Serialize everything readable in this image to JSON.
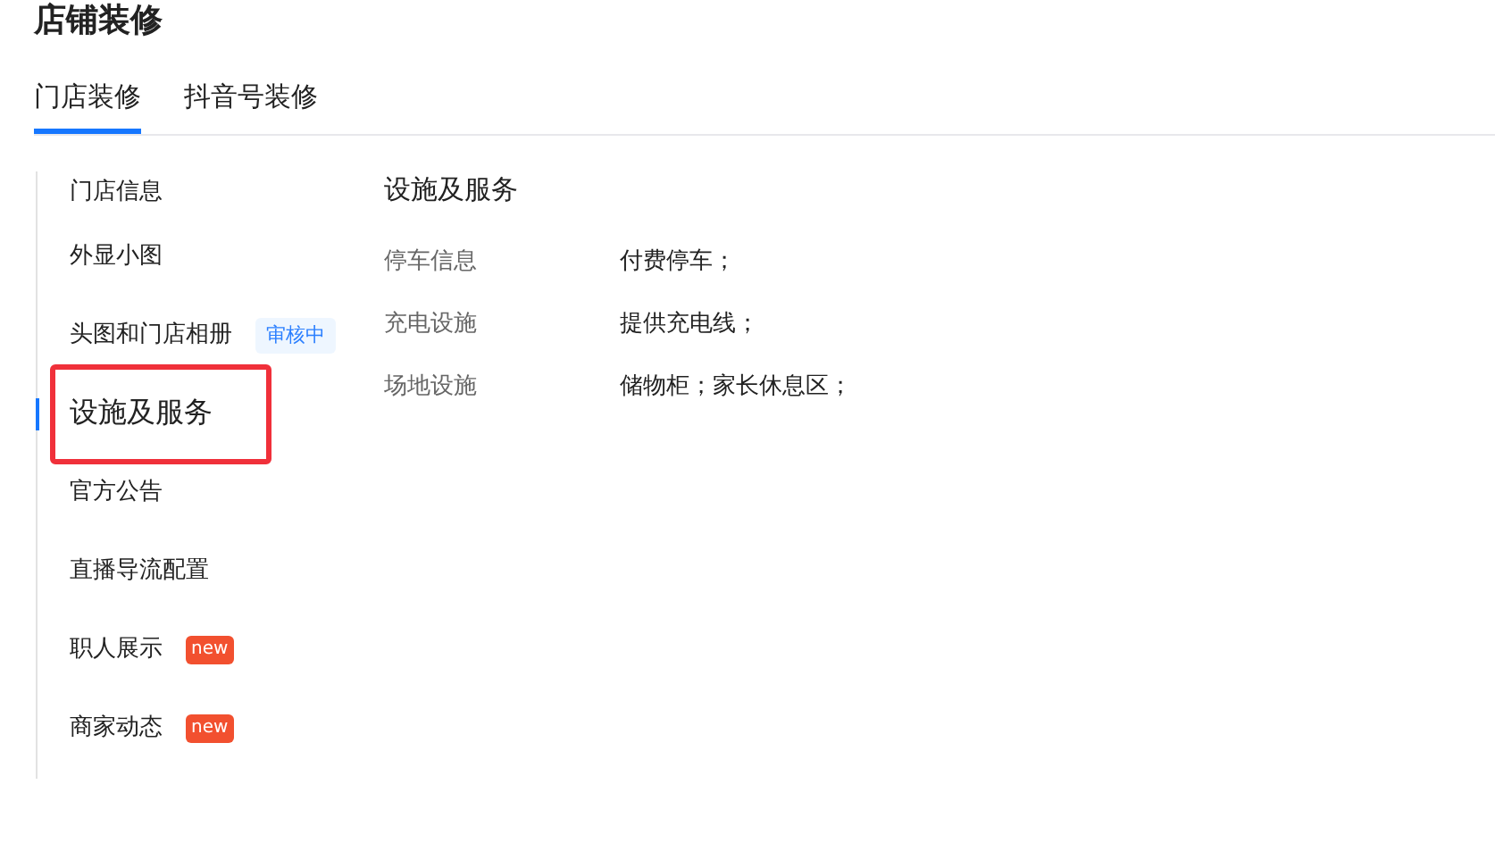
{
  "page_title": "店铺装修",
  "tabs": [
    {
      "label": "门店装修",
      "selected": true
    },
    {
      "label": "抖音号装修",
      "selected": false
    }
  ],
  "sidebar": {
    "items": [
      {
        "label": "门店信息",
        "selected": false,
        "highlighted": false
      },
      {
        "label": "外显小图",
        "selected": false,
        "highlighted": false
      },
      {
        "label": "头图和门店相册",
        "selected": false,
        "highlighted": false,
        "badge": {
          "kind": "status",
          "text": "审核中"
        }
      },
      {
        "label": "设施及服务",
        "selected": true,
        "highlighted": true
      },
      {
        "label": "官方公告",
        "selected": false,
        "highlighted": false
      },
      {
        "label": "直播导流配置",
        "selected": false,
        "highlighted": false
      },
      {
        "label": "职人展示",
        "selected": false,
        "highlighted": false,
        "badge": {
          "kind": "new",
          "text": "new"
        }
      },
      {
        "label": "商家动态",
        "selected": false,
        "highlighted": false,
        "badge": {
          "kind": "new",
          "text": "new"
        }
      }
    ]
  },
  "section": {
    "title": "设施及服务",
    "rows": [
      {
        "label": "停车信息",
        "value": "付费停车；"
      },
      {
        "label": "充电设施",
        "value": "提供充电线；"
      },
      {
        "label": "场地设施",
        "value": "储物柜；家长休息区；"
      }
    ]
  }
}
